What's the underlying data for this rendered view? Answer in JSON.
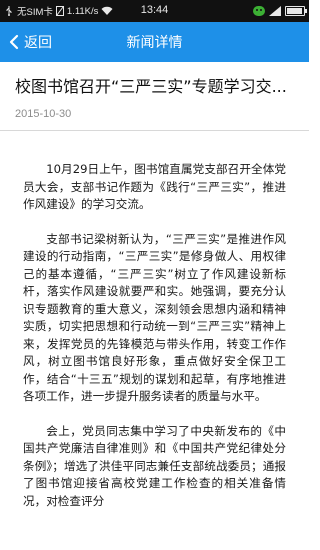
{
  "status_bar": {
    "sim": "无SIM卡",
    "speed": "1.11K/s",
    "time": "13:44",
    "icons": [
      "usb-icon",
      "nosim-icon",
      "wifi-icon",
      "wechat-icon",
      "signal-icon",
      "battery-icon"
    ]
  },
  "nav": {
    "back_label": "返回",
    "title": "新闻详情",
    "bar_color": "#1e90e8"
  },
  "article": {
    "title": "校图书馆召开“三严三实”专题学习交...",
    "date": "2015-10-30",
    "paragraphs": [
      "10月29日上午，图书馆直属党支部召开全体党员大会，支部书记作题为《践行“三严三实”，推进作风建设》的学习交流。",
      "支部书记梁树新认为，“三严三实”是推进作风建设的行动指南，“三严三实”是修身做人、用权律己的基本遵循，“三严三实”树立了作风建设新标杆，落实作风建设就要严和实。她强调，要充分认识专题教育的重大意义，深刻领会思想内涵和精神实质，切实把思想和行动统一到“三严三实”精神上来，发挥党员的先锋模范与带头作用，转变工作作风，树立图书馆良好形象，重点做好安全保卫工作，结合“十三五”规划的谋划和起草，有序地推进各项工作，进一步提升服务读者的质量与水平。",
      "会上，党员同志集中学习了中央新发布的《中国共产党廉洁自律准则》和《中国共产党纪律处分条例》；增选了洪佳平同志兼任支部统战委员；通报了图书馆迎接省高校党建工作检查的相关准备情况，对检查评分"
    ]
  }
}
